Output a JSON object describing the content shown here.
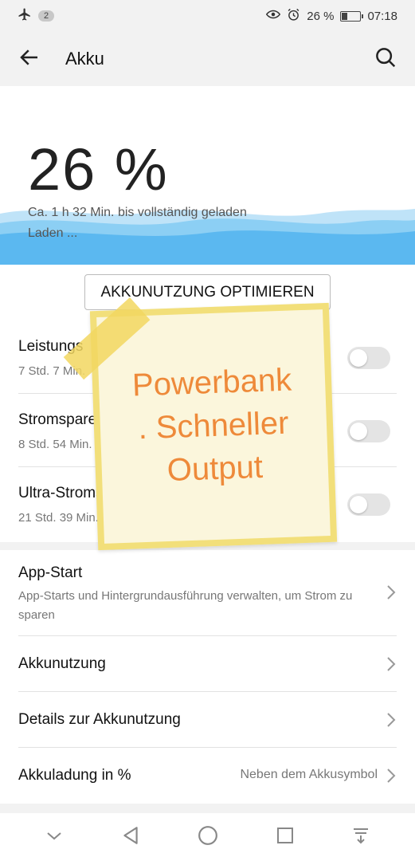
{
  "status_bar": {
    "notification_count": "2",
    "battery_percent": "26 %",
    "time": "07:18",
    "icons": [
      "airplane-mode-icon",
      "eye-comfort-icon",
      "alarm-icon",
      "battery-charging-icon"
    ]
  },
  "app_bar": {
    "title": "Akku"
  },
  "hero": {
    "percent": "26 %",
    "charge_time": "Ca. 1 h 32 Min. bis vollständig geladen",
    "charge_state": "Laden ...",
    "wave_color": "#5bb8f0"
  },
  "optimize_button": "AKKUNUTZUNG OPTIMIEREN",
  "modes": [
    {
      "title": "Leistungs",
      "subtitle": "7 Std. 7 Min.",
      "on": false
    },
    {
      "title": "Stromspare",
      "subtitle": "8 Std. 54 Min.",
      "on": false
    },
    {
      "title": "Ultra-Stromsp",
      "subtitle": "21 Std. 39 Min.",
      "on": false
    }
  ],
  "sticky_note": {
    "lines": [
      "Powerbank",
      ". Schneller",
      "Output"
    ],
    "text_color": "#ee8a3a"
  },
  "settings": {
    "app_start": {
      "title": "App-Start",
      "subtitle": "App-Starts und Hintergrundausführung verwalten, um Strom zu sparen"
    },
    "usage": {
      "title": "Akkunutzung"
    },
    "usage_details": {
      "title": "Details zur Akkunutzung"
    },
    "charge_percent": {
      "title": "Akkuladung in %",
      "value": "Neben dem Akkusymbol"
    }
  },
  "nav_bar": {
    "buttons": [
      "collapse-icon",
      "back-icon",
      "home-icon",
      "recents-icon",
      "notifications-pulldown-icon"
    ]
  }
}
